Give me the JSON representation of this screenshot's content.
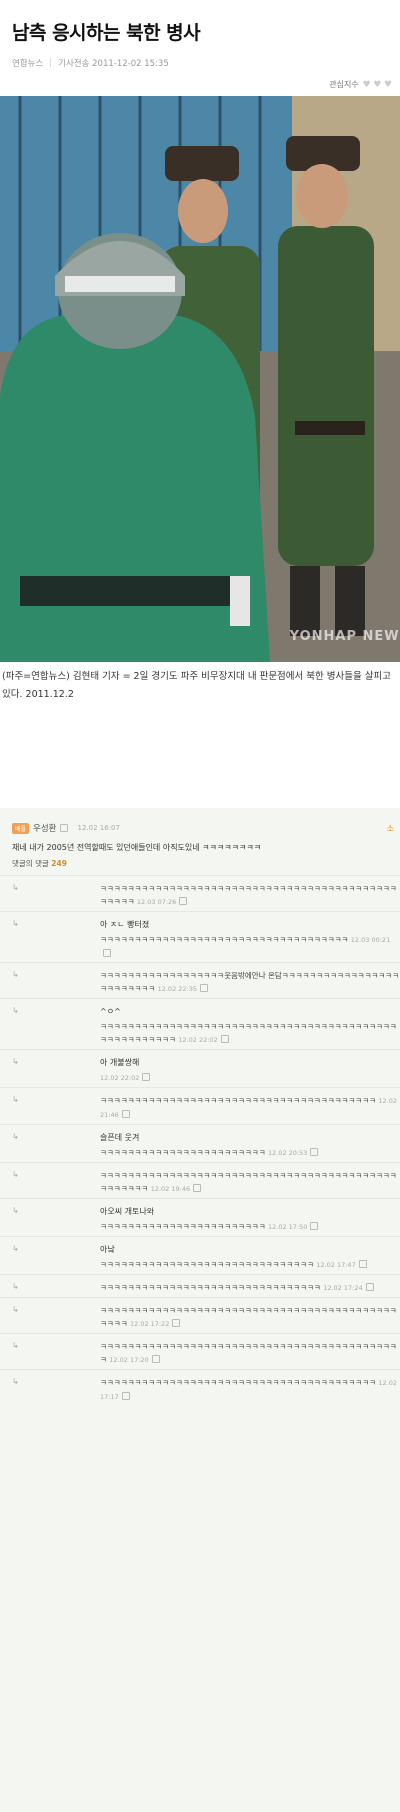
{
  "article": {
    "title": "남측 응시하는 북한 병사",
    "source": "연합뉴스",
    "sep": "|",
    "date": "기사전송 2011-12-02 15:35",
    "interest_label": "관심지수",
    "hearts": [
      "♥",
      "♥",
      "♥"
    ],
    "watermark": "YONHAP NEWS",
    "caption": "(파주=연합뉴스) 김현태 기자 = 2일 경기도 파주 비무장지대 내 판문점에서 북한 병사들을 살피고 있다. 2011.12.2"
  },
  "comments": {
    "badge": "베플",
    "author": "우성환",
    "time": "12.02 16:07",
    "top_right": "소",
    "text": "재네 내가 2005년 전역할때도 있던애들인데 아직도있네 ㅋㅋㅋㅋㅋㅋㅋㅋ",
    "count_label": "댓글의 댓글",
    "count": "249",
    "arrow": "↳",
    "replies": [
      {
        "name": "",
        "text": "ㅋㅋㅋㅋㅋㅋㅋㅋㅋㅋㅋㅋㅋㅋㅋㅋㅋㅋㅋㅋㅋㅋㅋㅋㅋㅋㅋㅋㅋㅋㅋㅋㅋㅋㅋㅋㅋㅋㅋㅋㅋㅋㅋㅋㅋㅋㅋㅋ",
        "time": "12.03 07:26"
      },
      {
        "name": "아 ㅈㄴ 빵터졌",
        "text": "ㅋㅋㅋㅋㅋㅋㅋㅋㅋㅋㅋㅋㅋㅋㅋㅋㅋㅋㅋㅋㅋㅋㅋㅋㅋㅋㅋㅋㅋㅋㅋㅋㅋㅋㅋㅋ",
        "time": "12.03 00:21"
      },
      {
        "name": "",
        "text": "ㅋㅋㅋㅋㅋㅋㅋㅋㅋㅋㅋㅋㅋㅋㅋㅋㅋㅋ웃음밖에안나 온담ㅋㅋㅋㅋㅋㅋㅋㅋㅋㅋㅋㅋㅋㅋㅋㅋㅋㅋㅋㅋㅋㅋㅋㅋㅋ",
        "time": "12.02 22:35"
      },
      {
        "name": "^ㅇ^",
        "text": "ㅋㅋㅋㅋㅋㅋㅋㅋㅋㅋㅋㅋㅋㅋㅋㅋㅋㅋㅋㅋㅋㅋㅋㅋㅋㅋㅋㅋㅋㅋㅋㅋㅋㅋㅋㅋㅋㅋㅋㅋㅋㅋㅋㅋㅋㅋㅋㅋㅋㅋㅋㅋㅋㅋ",
        "time": "12.02 22:02"
      },
      {
        "name": "아 개불쌍해",
        "text": "",
        "time": "12.02 22:02"
      },
      {
        "name": "",
        "text": "ㅋㅋㅋㅋㅋㅋㅋㅋㅋㅋㅋㅋㅋㅋㅋㅋㅋㅋㅋㅋㅋㅋㅋㅋㅋㅋㅋㅋㅋㅋㅋㅋㅋㅋㅋㅋㅋㅋㅋㅋ",
        "time": "12.02 21:46"
      },
      {
        "name": "슬픈데 웃겨",
        "text": "ㅋㅋㅋㅋㅋㅋㅋㅋㅋㅋㅋㅋㅋㅋㅋㅋㅋㅋㅋㅋㅋㅋㅋㅋ",
        "time": "12.02 20:53"
      },
      {
        "name": "",
        "text": "ㅋㅋㅋㅋㅋㅋㅋㅋㅋㅋㅋㅋㅋㅋㅋㅋㅋㅋㅋㅋㅋㅋㅋㅋㅋㅋㅋㅋㅋㅋㅋㅋㅋㅋㅋㅋㅋㅋㅋㅋㅋㅋㅋㅋㅋㅋㅋㅋㅋㅋ",
        "time": "12.02 19:46"
      },
      {
        "name": "아오씨 개토나와",
        "text": "ㅋㅋㅋㅋㅋㅋㅋㅋㅋㅋㅋㅋㅋㅋㅋㅋㅋㅋㅋㅋㅋㅋㅋㅋ",
        "time": "12.02 17:50"
      },
      {
        "name": "아낰",
        "text": "ㅋㅋㅋㅋㅋㅋㅋㅋㅋㅋㅋㅋㅋㅋㅋㅋㅋㅋㅋㅋㅋㅋㅋㅋㅋㅋㅋㅋㅋㅋㅋ",
        "time": "12.02 17:47"
      },
      {
        "name": "",
        "text": "ㅋㅋㅋㅋㅋㅋㅋㅋㅋㅋㅋㅋㅋㅋㅋㅋㅋㅋㅋㅋㅋㅋㅋㅋㅋㅋㅋㅋㅋㅋㅋㅋ",
        "time": "12.02 17:24"
      },
      {
        "name": "",
        "text": "ㅋㅋㅋㅋㅋㅋㅋㅋㅋㅋㅋㅋㅋㅋㅋㅋㅋㅋㅋㅋㅋㅋㅋㅋㅋㅋㅋㅋㅋㅋㅋㅋㅋㅋㅋㅋㅋㅋㅋㅋㅋㅋㅋㅋㅋㅋㅋ",
        "time": "12.02 17:22"
      },
      {
        "name": "",
        "text": "ㅋㅋㅋㅋㅋㅋㅋㅋㅋㅋㅋㅋㅋㅋㅋㅋㅋㅋㅋㅋㅋㅋㅋㅋㅋㅋㅋㅋㅋㅋㅋㅋㅋㅋㅋㅋㅋㅋㅋㅋㅋㅋㅋㅋ",
        "time": "12.02 17:20"
      },
      {
        "name": "",
        "text": "ㅋㅋㅋㅋㅋㅋㅋㅋㅋㅋㅋㅋㅋㅋㅋㅋㅋㅋㅋㅋㅋㅋㅋㅋㅋㅋㅋㅋㅋㅋㅋㅋㅋㅋㅋㅋㅋㅋㅋㅋ",
        "time": "12.02 17:17"
      }
    ]
  }
}
